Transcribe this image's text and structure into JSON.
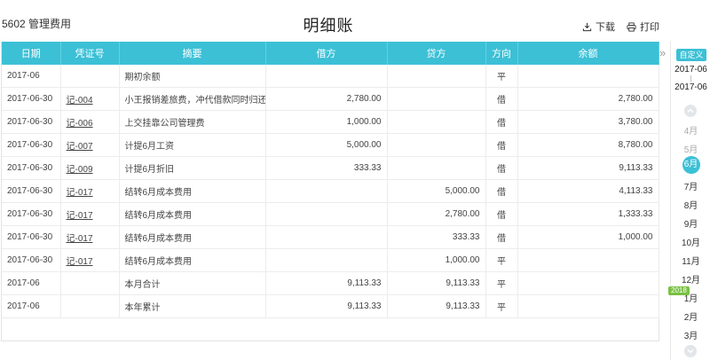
{
  "header": {
    "account": "5602 管理费用",
    "title": "明细账",
    "download_label": "下载",
    "print_label": "打印"
  },
  "table": {
    "columns": [
      "日期",
      "凭证号",
      "摘要",
      "借方",
      "贷方",
      "方向",
      "余额"
    ],
    "rows": [
      {
        "date": "2017-06",
        "voucher": "",
        "summary": "期初余额",
        "debit": "",
        "credit": "",
        "direction": "平",
        "balance": ""
      },
      {
        "date": "2017-06-30",
        "voucher": "记-004",
        "summary": "小王报销差旅费，冲代借款同时归还余款",
        "debit": "2,780.00",
        "credit": "",
        "direction": "借",
        "balance": "2,780.00"
      },
      {
        "date": "2017-06-30",
        "voucher": "记-006",
        "summary": "上交挂靠公司管理费",
        "debit": "1,000.00",
        "credit": "",
        "direction": "借",
        "balance": "3,780.00"
      },
      {
        "date": "2017-06-30",
        "voucher": "记-007",
        "summary": "计提6月工资",
        "debit": "5,000.00",
        "credit": "",
        "direction": "借",
        "balance": "8,780.00"
      },
      {
        "date": "2017-06-30",
        "voucher": "记-009",
        "summary": "计提6月折旧",
        "debit": "333.33",
        "credit": "",
        "direction": "借",
        "balance": "9,113.33"
      },
      {
        "date": "2017-06-30",
        "voucher": "记-017",
        "summary": "结转6月成本费用",
        "debit": "",
        "credit": "5,000.00",
        "direction": "借",
        "balance": "4,113.33"
      },
      {
        "date": "2017-06-30",
        "voucher": "记-017",
        "summary": "结转6月成本费用",
        "debit": "",
        "credit": "2,780.00",
        "direction": "借",
        "balance": "1,333.33"
      },
      {
        "date": "2017-06-30",
        "voucher": "记-017",
        "summary": "结转6月成本费用",
        "debit": "",
        "credit": "333.33",
        "direction": "借",
        "balance": "1,000.00"
      },
      {
        "date": "2017-06-30",
        "voucher": "记-017",
        "summary": "结转6月成本费用",
        "debit": "",
        "credit": "1,000.00",
        "direction": "平",
        "balance": ""
      },
      {
        "date": "2017-06",
        "voucher": "",
        "summary": "本月合计",
        "debit": "9,113.33",
        "credit": "9,113.33",
        "direction": "平",
        "balance": ""
      },
      {
        "date": "2017-06",
        "voucher": "",
        "summary": "本年累计",
        "debit": "9,113.33",
        "credit": "9,113.33",
        "direction": "平",
        "balance": ""
      }
    ]
  },
  "sidebar": {
    "collapse_glyph": "»",
    "custom_label": "自定义",
    "range_start": "2017-06",
    "range_sep": "|",
    "range_end": "2017-06",
    "year_badge": "2018",
    "months": [
      {
        "label": "4月",
        "state": "muted"
      },
      {
        "label": "5月",
        "state": "muted"
      },
      {
        "label": "6月",
        "state": "active"
      },
      {
        "label": "7月",
        "state": "normal"
      },
      {
        "label": "8月",
        "state": "normal"
      },
      {
        "label": "9月",
        "state": "normal"
      },
      {
        "label": "10月",
        "state": "normal"
      },
      {
        "label": "11月",
        "state": "normal"
      },
      {
        "label": "12月",
        "state": "normal"
      },
      {
        "label": "1月",
        "state": "normal"
      },
      {
        "label": "2月",
        "state": "normal"
      },
      {
        "label": "3月",
        "state": "normal"
      }
    ]
  },
  "colors": {
    "accent": "#3cc0d6",
    "year_badge": "#7ac143"
  }
}
